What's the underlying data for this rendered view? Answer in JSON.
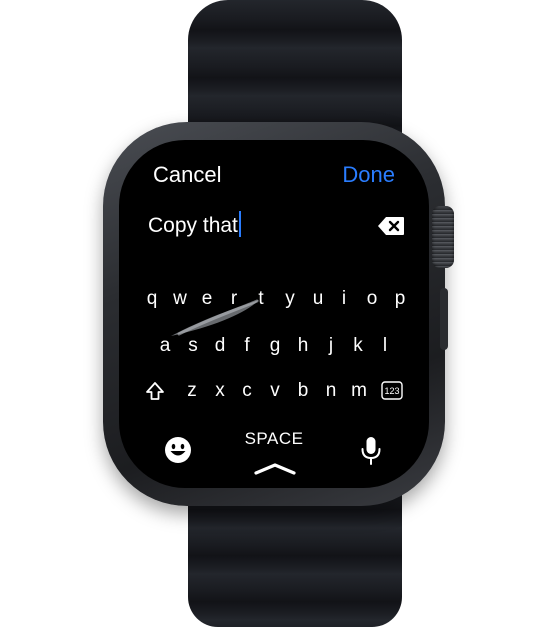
{
  "header": {
    "cancel_label": "Cancel",
    "done_label": "Done"
  },
  "text_field": {
    "value": "Copy that"
  },
  "keyboard": {
    "row1": [
      "q",
      "w",
      "e",
      "r",
      "t",
      "y",
      "u",
      "i",
      "o",
      "p"
    ],
    "row2": [
      "a",
      "s",
      "d",
      "f",
      "g",
      "h",
      "j",
      "k",
      "l"
    ],
    "row3": [
      "z",
      "x",
      "c",
      "v",
      "b",
      "n",
      "m"
    ],
    "numbers_label": "123",
    "space_label": "SPACE",
    "icons": {
      "delete": "delete-backspace-icon",
      "shift": "shift-arrow-icon",
      "emoji": "smiley-face-icon",
      "dictation": "microphone-icon",
      "dismiss": "chevron-up-icon"
    }
  },
  "colors": {
    "accent": "#2a7dff",
    "screen_background": "#000000",
    "text": "#ffffff"
  }
}
